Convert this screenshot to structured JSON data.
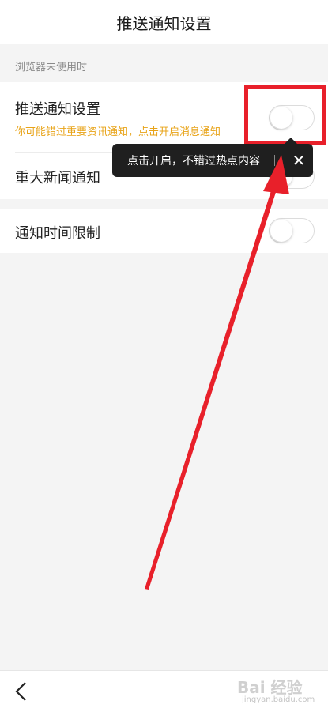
{
  "header": {
    "title": "推送通知设置"
  },
  "section": {
    "label": "浏览器未使用时"
  },
  "rows": [
    {
      "title": "推送通知设置",
      "subtitle": "你可能错过重要资讯通知，点击开启消息通知",
      "switch_on": false
    },
    {
      "title": "重大新闻通知",
      "switch_on": false
    },
    {
      "title": "通知时间限制",
      "switch_on": false
    }
  ],
  "tooltip": {
    "text": "点击开启，不错过热点内容",
    "close_symbol": "✕"
  },
  "nav": {
    "back_icon": "chevron-left-icon"
  },
  "watermark": {
    "main": "Bai 经验",
    "sub": "jingyan.baidu.com"
  },
  "colors": {
    "highlight": "#e8202a",
    "subtitle": "#e8a317",
    "tooltip_bg": "#1f1f1f"
  }
}
